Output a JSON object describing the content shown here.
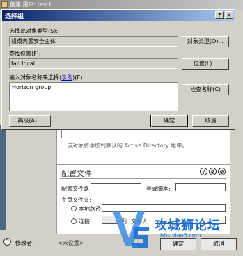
{
  "background": {
    "title": "创建 用户: test1",
    "ad_note": "该对象将添加到默认的 Active Directory 组中。",
    "profile": {
      "title": "配置文件",
      "help_glyph": "?",
      "collapse_glyph": "⊗",
      "close_glyph": "⊗",
      "profile_path_label": "配置文件路",
      "logon_script_label": "登录脚本:",
      "home_folder_label": "主页文件夹:",
      "local_path_label": "本地路径",
      "connect_label": "连接",
      "to_label": "到",
      "drive_value": "",
      "files_label": "文件人:"
    },
    "modifier_label": "修改者:",
    "modifier_value": "<未设置>",
    "ok_label": "确定",
    "cancel_label": "取消"
  },
  "dialog": {
    "title": "选择组",
    "help_glyph": "?",
    "close_glyph": "×",
    "object_type_label": "选择此对象类型(S):",
    "object_type_value": "组或内置安全主体",
    "object_types_button": "对象类型(O)...",
    "location_label": "查找位置(F):",
    "location_value": "fan.local",
    "locations_button": "位置(L)...",
    "names_label_prefix": "输入对象名称来选择(",
    "names_label_link": "示例",
    "names_label_suffix": ")(E):",
    "names_value": "Horizon group",
    "check_names_button": "检查名称(C)",
    "advanced_button": "高级(A)...",
    "ok_button": "确定",
    "cancel_button": "取消"
  },
  "watermark": {
    "text": "攻城狮论坛",
    "url": "bbs.vlan5.com"
  }
}
